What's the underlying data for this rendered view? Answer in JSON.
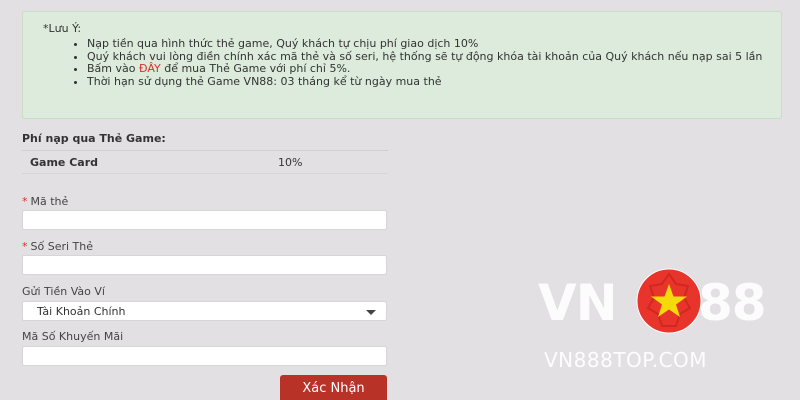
{
  "notice": {
    "title": "*Lưu Ý:",
    "items": [
      {
        "text": "Nạp tiền qua hình thức thẻ game, Quý khách tự chịu phí giao dịch 10%"
      },
      {
        "text": "Quý khách vui lòng điền chính xác mã thẻ và số seri, hệ thống sẽ tự động khóa tài khoản của Quý khách nếu nạp sai 5 lần"
      },
      {
        "prefix": "Bấm vào ",
        "link": "ĐÂY",
        "suffix": " để mua Thẻ Game với phí chỉ 5%."
      },
      {
        "text": "Thời hạn sử dụng thẻ Game VN88: 03 tháng kể từ ngày mua thẻ"
      }
    ]
  },
  "fee": {
    "heading": "Phí nạp qua Thẻ Game:",
    "rows": [
      {
        "name": "Game Card",
        "value": "10%"
      }
    ]
  },
  "form": {
    "card_code_label": "Mã thẻ",
    "serial_label": "Số Seri Thẻ",
    "wallet_label": "Gửi Tiền Vào Ví",
    "wallet_selected": "Tài Khoản Chính",
    "promo_label": "Mã Số Khuyến Mãi",
    "required_mark": "*",
    "submit_label": "Xác Nhận"
  },
  "watermark": {
    "brand_left": "VN",
    "brand_right": "88",
    "domain": "VN888TOP.COM"
  },
  "colors": {
    "notice_bg": "#dcebdb",
    "accent_red": "#b83227",
    "required_red": "#d9302a"
  }
}
